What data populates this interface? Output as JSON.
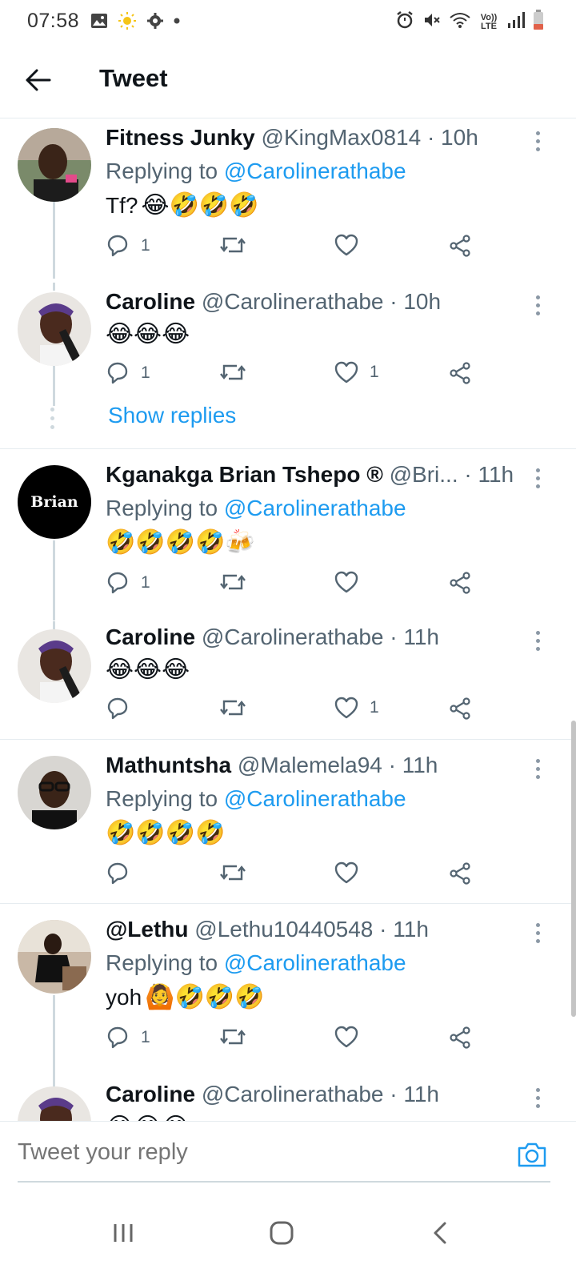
{
  "status_bar": {
    "time": "07:58",
    "network": "Vo)) LTE",
    "left_icons": [
      "image-icon",
      "sun-icon",
      "gear-icon",
      "dot-icon"
    ],
    "right_icons": [
      "alarm-icon",
      "mute-icon",
      "wifi-icon",
      "volte-icon",
      "signal-icon",
      "battery-icon"
    ]
  },
  "header": {
    "title": "Tweet"
  },
  "tweets": [
    {
      "name": "Fitness Junky",
      "meta": "@KingMax0814 · 10h",
      "replying_prefix": "Replying to",
      "replying_handle": "@Carolinerathabe",
      "text": "Tf?",
      "emojis": "😂🤣🤣🤣",
      "reply_count": "1",
      "retweet_count": "",
      "like_count": ""
    },
    {
      "name": "Caroline",
      "meta": "@Carolinerathabe · 10h",
      "text": "",
      "emojis": "😂😂😂",
      "reply_count": "1",
      "retweet_count": "",
      "like_count": "1",
      "show_replies": "Show replies"
    },
    {
      "name": "Kganakga Brian Tshepo ®",
      "meta": "@Bri... · 11h",
      "replying_prefix": "Replying to",
      "replying_handle": "@Carolinerathabe",
      "text": "",
      "emojis": "🤣🤣🤣🤣🍻",
      "avatar_text": "Brian",
      "reply_count": "1",
      "retweet_count": "",
      "like_count": ""
    },
    {
      "name": "Caroline",
      "meta": "@Carolinerathabe · 11h",
      "text": "",
      "emojis": "😂😂😂",
      "reply_count": "",
      "retweet_count": "",
      "like_count": "1"
    },
    {
      "name": "Mathuntsha",
      "meta": "@Malemela94 · 11h",
      "replying_prefix": "Replying to",
      "replying_handle": "@Carolinerathabe",
      "text": "",
      "emojis": "🤣🤣🤣🤣",
      "reply_count": "",
      "retweet_count": "",
      "like_count": ""
    },
    {
      "name": "@Lethu",
      "meta": "@Lethu10440548 · 11h",
      "replying_prefix": "Replying to",
      "replying_handle": "@Carolinerathabe",
      "text": "yoh",
      "emojis": "🙆🤣🤣🤣",
      "reply_count": "1",
      "retweet_count": "",
      "like_count": ""
    },
    {
      "name": "Caroline",
      "meta": "@Carolinerathabe · 11h",
      "text": "",
      "emojis": "😂😂😂"
    }
  ],
  "composer": {
    "placeholder": "Tweet your reply"
  },
  "colors": {
    "accent": "#1d9bf0",
    "text": "#0f1419",
    "secondary": "#536471",
    "divider": "#e6ecf0"
  }
}
